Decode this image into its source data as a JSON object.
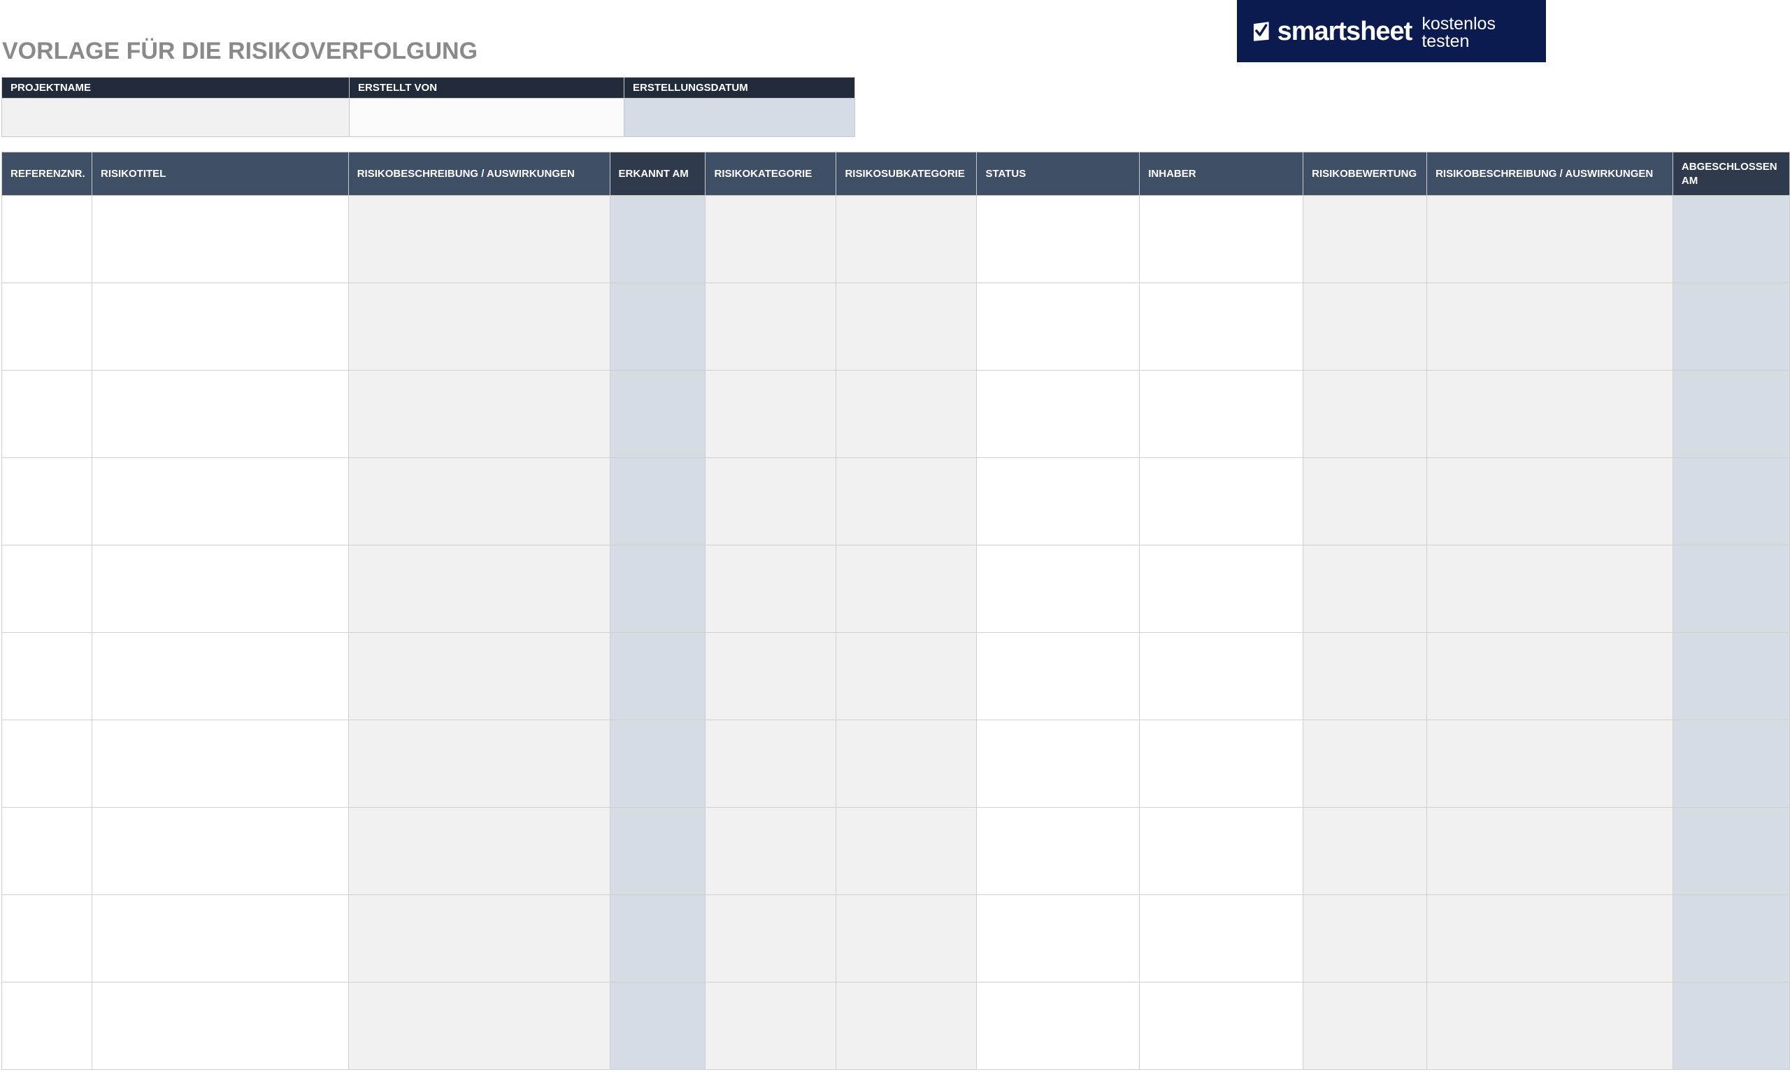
{
  "page": {
    "title": "VORLAGE FÜR DIE RISIKOVERFOLGUNG"
  },
  "banner": {
    "brand": "smartsheet",
    "cta": "kostenlos testen",
    "icon": "smartsheet-check-icon",
    "background_color": "#0b1a4f"
  },
  "project_info": {
    "headers": [
      "PROJEKTNAME",
      "ERSTELLT VON",
      "ERSTELLUNGSDATUM"
    ],
    "values": [
      "",
      "",
      ""
    ]
  },
  "risk_table": {
    "headers": [
      "REFERENZNR.",
      "RISIKOTITEL",
      "RISIKOBESCHREIBUNG / AUSWIRKUNGEN",
      "ERKANNT AM",
      "RISIKOKATEGORIE",
      "RISIKOSUBKATEGORIE",
      "STATUS",
      "INHABER",
      "RISIKOBEWERTUNG",
      "RISIKOBESCHREIBUNG / AUSWIRKUNGEN",
      "ABGESCHLOSSEN AM"
    ],
    "row_count": 10,
    "rows": []
  },
  "colors": {
    "header_dark": "#222b3a",
    "header_slate": "#3f4f66",
    "header_slate_dark": "#2f3b4d",
    "cell_grey": "#f1f1f1",
    "cell_blue": "#d5dce4",
    "title_grey": "#8a8a8a"
  }
}
